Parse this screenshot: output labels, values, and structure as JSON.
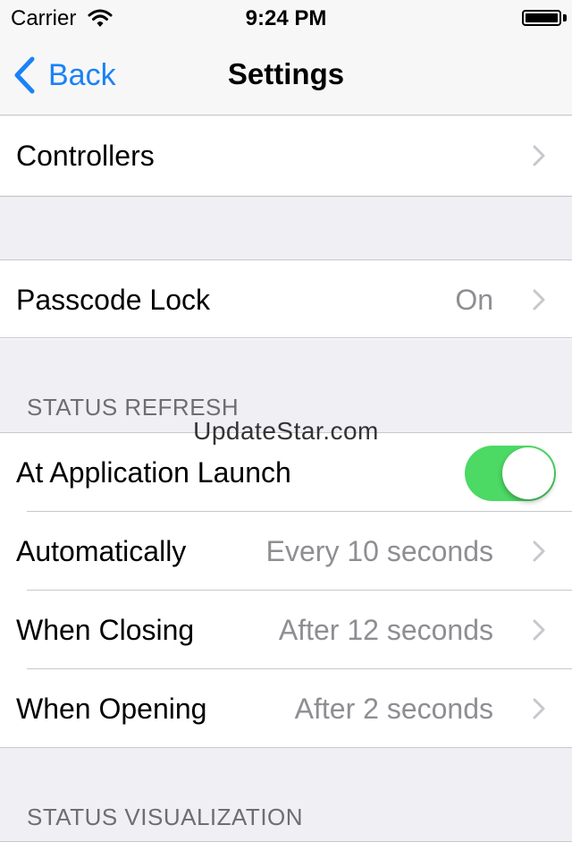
{
  "status_bar": {
    "carrier": "Carrier",
    "time": "9:24 PM"
  },
  "nav": {
    "back_label": "Back",
    "title": "Settings"
  },
  "rows": {
    "controllers": {
      "label": "Controllers"
    },
    "passcode": {
      "label": "Passcode Lock",
      "value": "On"
    }
  },
  "status_refresh": {
    "header": "STATUS REFRESH",
    "at_launch": {
      "label": "At Application Launch",
      "toggle_on": true
    },
    "automatically": {
      "label": "Automatically",
      "value": "Every 10 seconds"
    },
    "when_closing": {
      "label": "When Closing",
      "value": "After 12 seconds"
    },
    "when_opening": {
      "label": "When Opening",
      "value": "After 2 seconds"
    }
  },
  "status_visualization": {
    "header": "STATUS VISUALIZATION"
  },
  "watermark": "UpdateStar.com",
  "colors": {
    "accent": "#1a82f7",
    "toggle_on": "#4cd964",
    "background": "#efeff4",
    "secondary_text": "#8e8e93"
  }
}
